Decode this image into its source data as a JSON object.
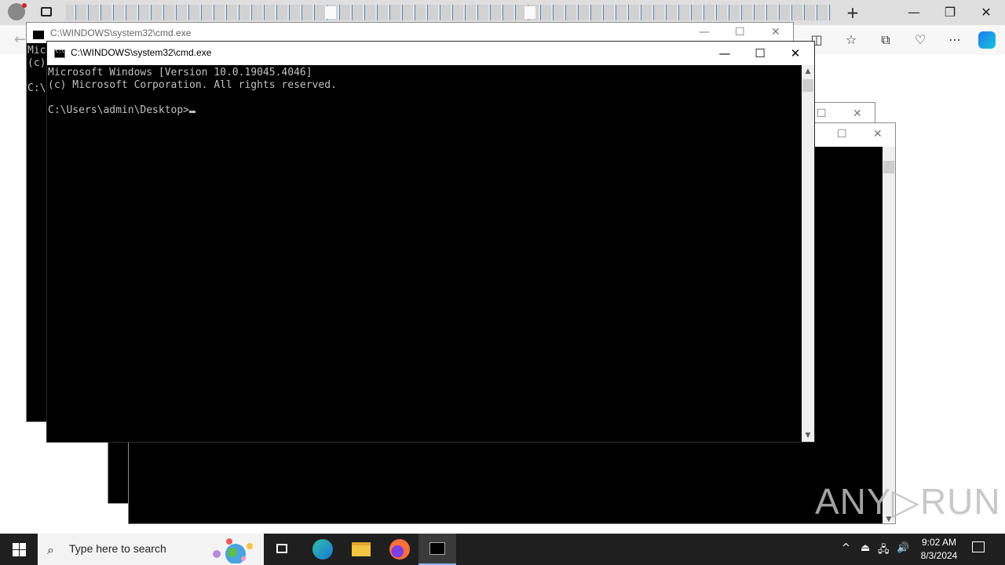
{
  "browser": {
    "new_tab": "+",
    "minimize": "—",
    "restore": "❐",
    "close": "✕"
  },
  "bg_windows": {
    "back_title": "C:\\WINDOWS\\system32\\cmd.exe",
    "back_lines": [
      "Mic",
      "(c)",
      "",
      "C:\\"
    ]
  },
  "cmd": {
    "title": "C:\\WINDOWS\\system32\\cmd.exe",
    "lines": [
      "Microsoft Windows [Version 10.0.19045.4046]",
      "(c) Microsoft Corporation. All rights reserved.",
      "",
      "C:\\Users\\admin\\Desktop>"
    ],
    "minimize": "—",
    "maximize": "☐",
    "close": "✕"
  },
  "watermark": "ANY▷RUN",
  "taskbar": {
    "search_placeholder": "Type here to search",
    "time": "9:02 AM",
    "date": "8/3/2024"
  }
}
